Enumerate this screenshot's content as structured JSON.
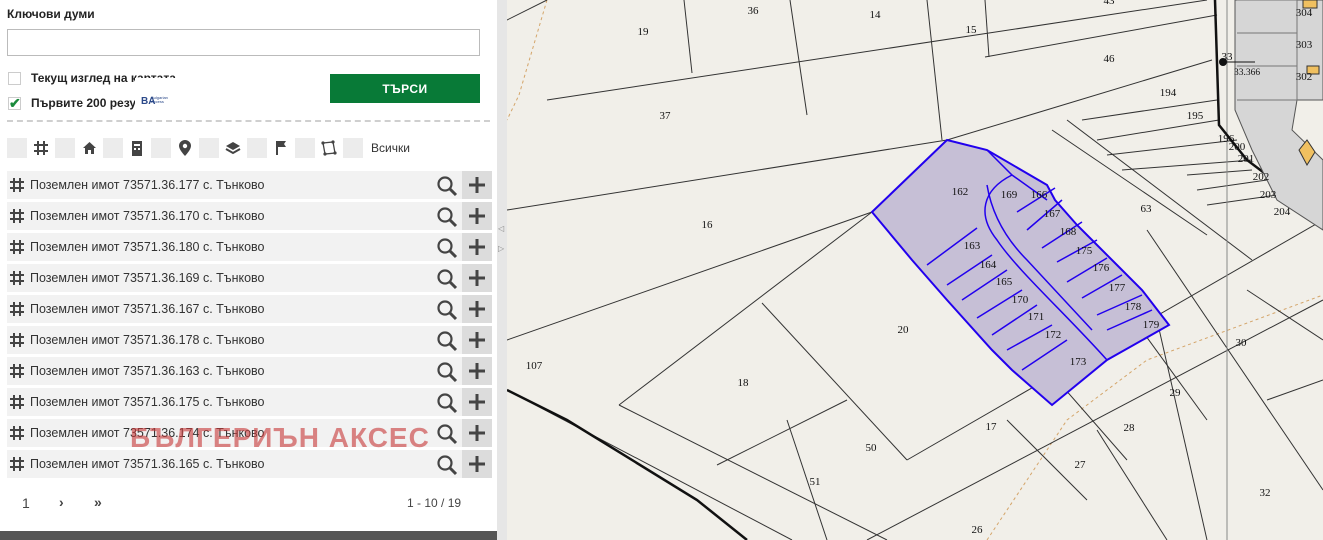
{
  "search": {
    "keywords_label": "Ключови думи",
    "keywords_value": "",
    "current_view_label": "Текущ изглед на картата",
    "first_200_label": "Първите 200 резултата",
    "button_label": "ТЪРСИ"
  },
  "logo": {
    "mark": "BA",
    "text": "Bulgarian Access"
  },
  "filters": {
    "all_label": "Всички"
  },
  "results": [
    {
      "label": "Поземлен имот 73571.36.177 с. Тънково"
    },
    {
      "label": "Поземлен имот 73571.36.170 с. Тънково"
    },
    {
      "label": "Поземлен имот 73571.36.180 с. Тънково"
    },
    {
      "label": "Поземлен имот 73571.36.169 с. Тънково"
    },
    {
      "label": "Поземлен имот 73571.36.167 с. Тънково"
    },
    {
      "label": "Поземлен имот 73571.36.178 с. Тънково"
    },
    {
      "label": "Поземлен имот 73571.36.163 с. Тънково"
    },
    {
      "label": "Поземлен имот 73571.36.175 с. Тънково"
    },
    {
      "label": "Поземлен имот 73571.36.174 с. Тънково"
    },
    {
      "label": "Поземлен имот 73571.36.165 с. Тънково"
    }
  ],
  "pagination": {
    "page": "1",
    "next": "›",
    "last": "»",
    "range": "1 - 10 / 19"
  },
  "watermark": "БЪЛГЕРИЪН АКСЕС",
  "map": {
    "labels": [
      "43",
      "36",
      "14",
      "15",
      "19",
      "46",
      "304",
      "303",
      "302",
      "33",
      "33.366",
      "194",
      "195",
      "196",
      "200",
      "201",
      "202",
      "203",
      "204",
      "37",
      "16",
      "63",
      "162",
      "169",
      "166",
      "167",
      "168",
      "175",
      "176",
      "177",
      "178",
      "179",
      "163",
      "164",
      "165",
      "170",
      "171",
      "172",
      "173",
      "20",
      "30",
      "107",
      "18",
      "29",
      "28",
      "17",
      "50",
      "27",
      "51",
      "32",
      "26"
    ]
  },
  "colors": {
    "accent": "#087a37",
    "parcel_fill": "#c6bfd6",
    "parcel_stroke": "#2200ee",
    "map_bg": "#f1efe9"
  }
}
